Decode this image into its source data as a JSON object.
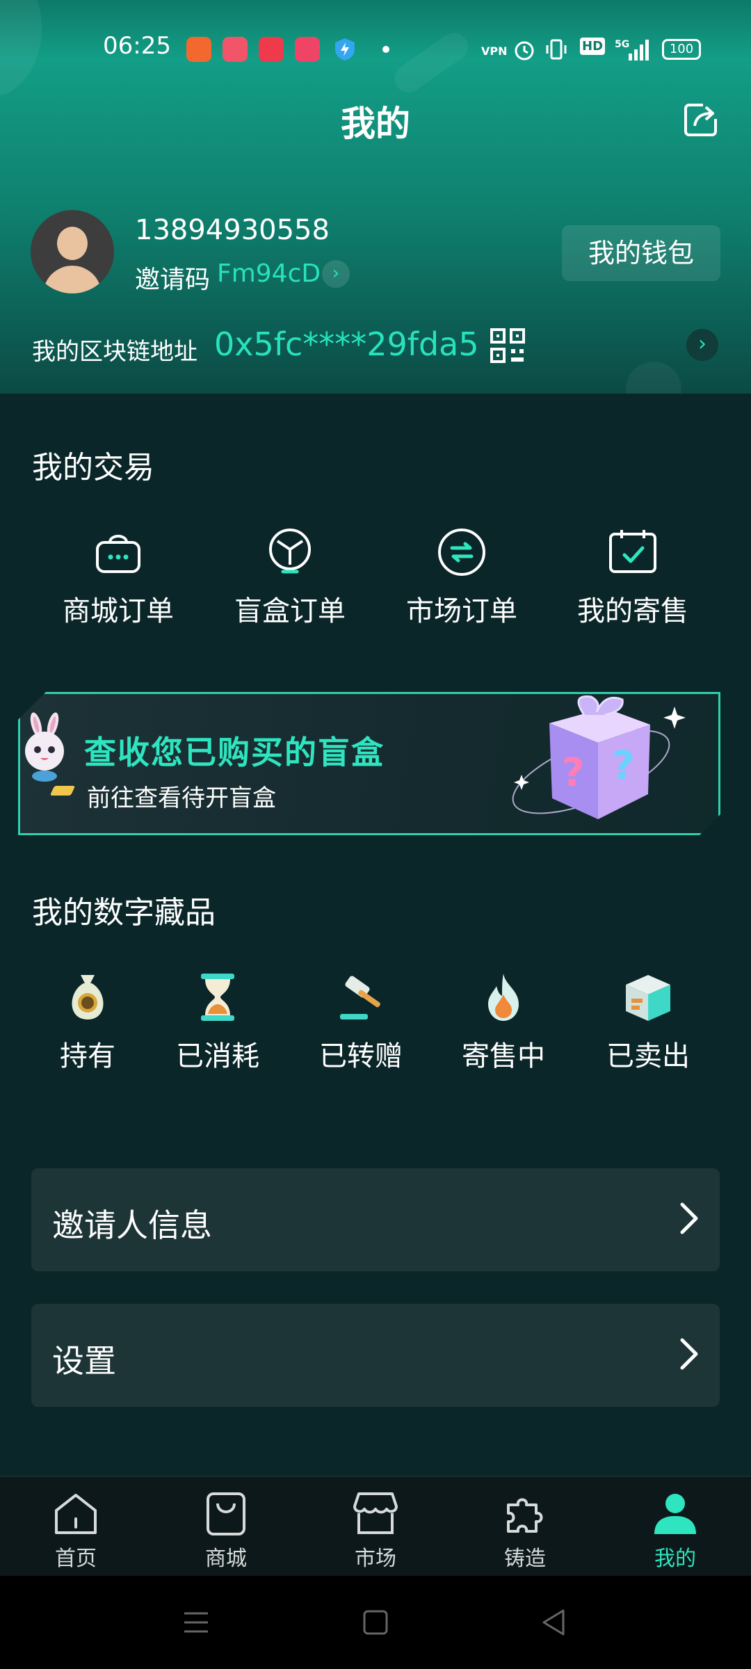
{
  "status_bar": {
    "time": "06:25",
    "right_icons": [
      "vpn-icon",
      "alarm-icon",
      "vibrate-icon",
      "hd-icon",
      "signal-5g-icon",
      "battery-icon"
    ],
    "vpn_text": "VPN",
    "hd_text": "HD",
    "network_text": "5G",
    "battery_text": "100"
  },
  "header": {
    "title": "我的",
    "share_icon": "share-icon"
  },
  "profile": {
    "phone": "13894930558",
    "invite_label": "邀请码",
    "invite_code": "Fm94cD",
    "wallet_button": "我的钱包",
    "chain_label": "我的区块链地址",
    "chain_address": "0x5fc****29fda5"
  },
  "trades": {
    "title": "我的交易",
    "items": [
      {
        "label": "商城订单",
        "icon": "shopping-bag-icon"
      },
      {
        "label": "盲盒订单",
        "icon": "blind-box-icon"
      },
      {
        "label": "市场订单",
        "icon": "exchange-icon"
      },
      {
        "label": "我的寄售",
        "icon": "calendar-check-icon"
      }
    ]
  },
  "banner": {
    "title": "查收您已购买的盲盒",
    "subtitle": "前往查看待开盲盒"
  },
  "collections": {
    "title": "我的数字藏品",
    "items": [
      {
        "label": "持有",
        "icon": "money-bag-icon"
      },
      {
        "label": "已消耗",
        "icon": "hourglass-icon"
      },
      {
        "label": "已转赠",
        "icon": "gavel-icon"
      },
      {
        "label": "寄售中",
        "icon": "fire-icon"
      },
      {
        "label": "已卖出",
        "icon": "box-icon"
      }
    ]
  },
  "menu": {
    "inviter": "邀请人信息",
    "settings": "设置"
  },
  "nav": {
    "items": [
      {
        "label": "首页",
        "icon": "home-icon"
      },
      {
        "label": "商城",
        "icon": "bag-icon"
      },
      {
        "label": "市场",
        "icon": "store-icon"
      },
      {
        "label": "铸造",
        "icon": "puzzle-icon"
      },
      {
        "label": "我的",
        "icon": "user-icon"
      }
    ],
    "active_index": 4
  },
  "colors": {
    "accent": "#2ee5c0",
    "background": "#0b2629",
    "header_gradient_top": "#139e87"
  }
}
